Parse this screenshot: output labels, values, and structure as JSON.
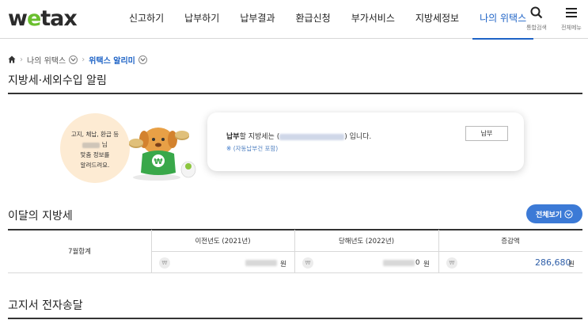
{
  "header": {
    "logo": {
      "left": "w",
      "o": "e",
      "right": "tax"
    },
    "nav": [
      "신고하기",
      "납부하기",
      "납부결과",
      "환급신청",
      "부가서비스",
      "지방세정보",
      "나의 위택스"
    ],
    "search_caption": "통합검색",
    "menu_caption": "전체메뉴"
  },
  "breadcrumb": {
    "item1": "나의 위택스",
    "current": "위택스 알리미"
  },
  "page_title": "지방세·세외수입 알림",
  "banner": {
    "bubble_line1": "고지, 체납, 환급 등",
    "bubble_suffix": "님",
    "bubble_line3": "맞춤 정보를",
    "bubble_line4": "알려드려요.",
    "msg_bold": "납부",
    "msg_mid": "할 지방세는",
    "msg_paren_open": "(",
    "msg_end": ") 입니다.",
    "note_mark": "※",
    "note_text": "(자동납부건 포함)",
    "pay_button": "납부"
  },
  "monthly": {
    "title": "이달의 지방세",
    "view_all": "전체보기",
    "row_label": "7월합계",
    "headers": [
      "이전년도 (2021년)",
      "당해년도 (2022년)",
      "증감액"
    ],
    "won_symbol": "₩",
    "unit": "원",
    "current_tail": "0",
    "diff_value": "286,680"
  },
  "notice": {
    "title": "고지서 전자송달"
  },
  "colors": {
    "accent": "#1e63c6",
    "button": "#3c7ad6",
    "logo_green": "#6abf2e"
  }
}
